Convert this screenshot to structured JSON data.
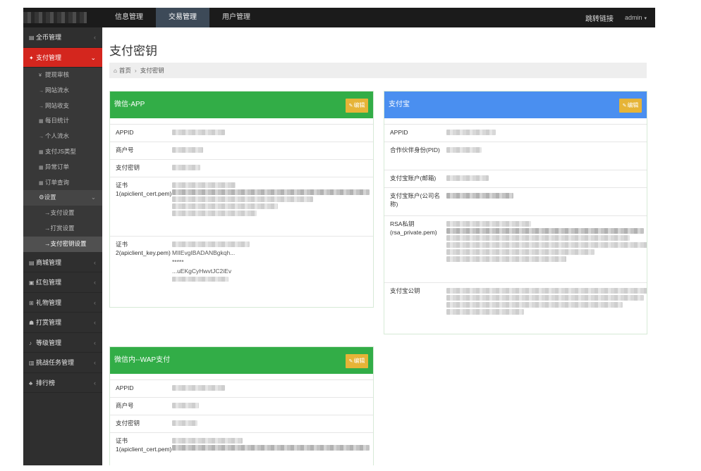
{
  "topbar": {
    "nav": [
      "信息管理",
      "交易管理",
      "用户管理"
    ],
    "active_nav": "交易管理",
    "jump_link": "跳转链接",
    "user": "admin"
  },
  "sidebar": {
    "items_top": [
      {
        "label": "全币管理",
        "icon": "cart-icon"
      },
      {
        "label": "支付管理",
        "icon": "cogs-icon"
      }
    ],
    "sub_items": [
      {
        "label": "提现审核",
        "icon": "yen-icon"
      },
      {
        "label": "网站流水",
        "icon": "arrow-right-icon"
      },
      {
        "label": "网站收支",
        "icon": "arrow-right-icon"
      },
      {
        "label": "每日统计",
        "icon": "grid-icon"
      },
      {
        "label": "个人流水",
        "icon": "arrow-right-icon"
      },
      {
        "label": "支付JS类型",
        "icon": "grid-icon"
      },
      {
        "label": "异常订单",
        "icon": "grid-icon"
      },
      {
        "label": "订单查询",
        "icon": "grid-icon"
      }
    ],
    "settings_label": "设置",
    "settings_items": [
      "支付设置",
      "打赏设置",
      "支付密钥设置"
    ],
    "items_bottom": [
      {
        "label": "商城管理",
        "icon": "cart-icon"
      },
      {
        "label": "红包管理",
        "icon": "briefcase-icon"
      },
      {
        "label": "礼物管理",
        "icon": "gift-icon"
      },
      {
        "label": "打赏管理",
        "icon": "users-icon"
      },
      {
        "label": "等级管理",
        "icon": "music-icon"
      },
      {
        "label": "挑战任务管理",
        "icon": "list-icon"
      },
      {
        "label": "排行榜",
        "icon": "sitemap-icon"
      }
    ]
  },
  "main": {
    "title": "支付密钥",
    "breadcrumb_home": "首页",
    "breadcrumb_current": "支付密钥",
    "edit_label": "编辑"
  },
  "wechat_app": {
    "title": "微信-APP",
    "rows": [
      {
        "label": "APPID"
      },
      {
        "label": "商户号"
      },
      {
        "label": "支付密钥"
      },
      {
        "label": "证书1(apiclient_cert.pem)"
      },
      {
        "label": "证书2(apiclient_key.pem)",
        "visible_text": [
          "MIIEvgIBADANBgkqh...",
          "*****",
          "...uEKgCyHwvtJC2iEv"
        ]
      }
    ]
  },
  "alipay": {
    "title": "支付宝",
    "rows": [
      {
        "label": "APPID"
      },
      {
        "label": "合作伙伴身份(PID)"
      },
      {
        "label": "支付宝账户(邮箱)"
      },
      {
        "label": "支付宝账户(公司名称)"
      },
      {
        "label": "RSA私钥(rsa_private.pem)"
      },
      {
        "label": "支付宝公钥"
      }
    ]
  },
  "wechat_wap": {
    "title": "微信内--WAP支付",
    "rows": [
      {
        "label": "APPID"
      },
      {
        "label": "商户号"
      },
      {
        "label": "支付密钥"
      },
      {
        "label": "证书1(apiclient_cert.pem)"
      }
    ]
  },
  "colors": {
    "topbar": "#1b1b1b",
    "sidebar": "#2f2f2f",
    "active_red": "#d4261e",
    "green": "#32ad47",
    "blue": "#4a8ff0",
    "edit_yellow": "#e6b437"
  }
}
